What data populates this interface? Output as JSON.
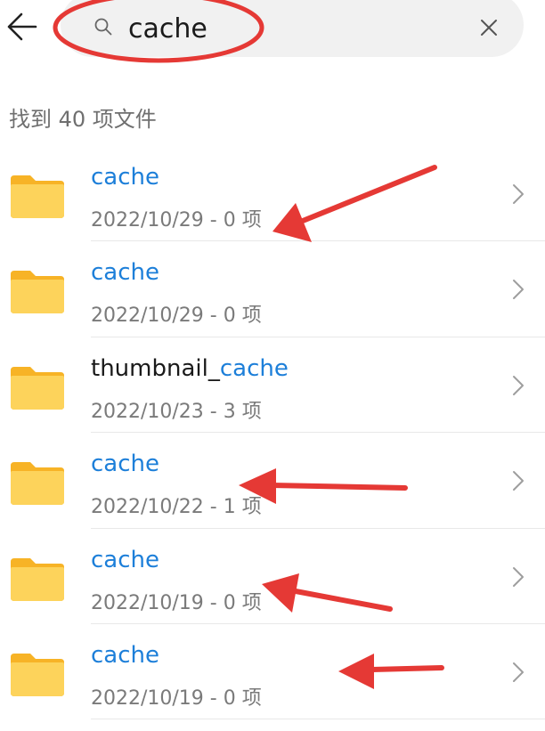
{
  "header": {
    "back_icon": "arrow-left-icon",
    "search": {
      "icon": "search-icon",
      "value": "cache",
      "clear_icon": "close-icon"
    }
  },
  "result_count": "找到 40 项文件",
  "highlight_color": "#1d7fd9",
  "folder_color": "#fbbf24",
  "annotation_color": "#e53935",
  "items": [
    {
      "name_prefix": "",
      "name_match": "cache",
      "date": "2022/10/29",
      "sep": " - ",
      "count": "0 项"
    },
    {
      "name_prefix": "",
      "name_match": "cache",
      "date": "2022/10/29",
      "sep": " - ",
      "count": "0 项"
    },
    {
      "name_prefix": "thumbnail_",
      "name_match": "cache",
      "date": "2022/10/23",
      "sep": " - ",
      "count": "3 项"
    },
    {
      "name_prefix": "",
      "name_match": "cache",
      "date": "2022/10/22",
      "sep": " - ",
      "count": "1 项"
    },
    {
      "name_prefix": "",
      "name_match": "cache",
      "date": "2022/10/19",
      "sep": " - ",
      "count": "0 项"
    },
    {
      "name_prefix": "",
      "name_match": "cache",
      "date": "2022/10/19",
      "sep": " - ",
      "count": "0 项"
    }
  ]
}
